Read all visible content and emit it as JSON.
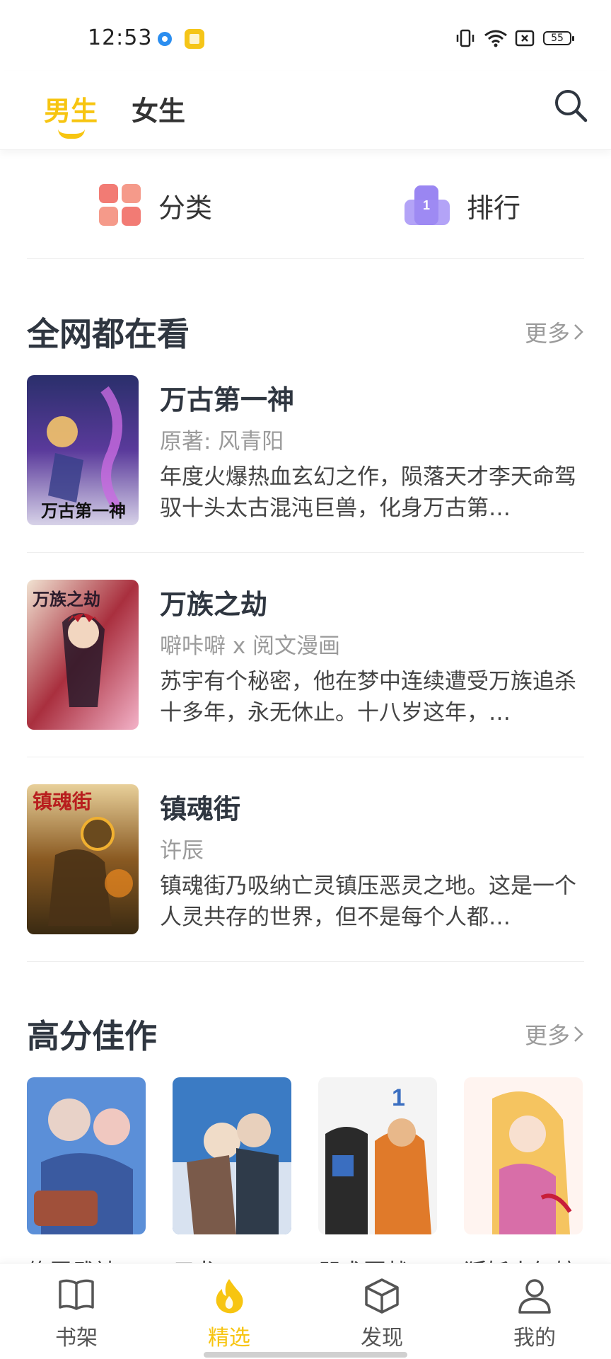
{
  "status": {
    "time": "12:53",
    "battery": "55",
    "icons": [
      "browser-icon",
      "notes-icon",
      "vibrate-icon",
      "wifi-icon",
      "sim-icon",
      "battery-icon"
    ]
  },
  "top_tabs": {
    "male": "男生",
    "female": "女生",
    "active": "male",
    "search_icon": "search-icon"
  },
  "quick": {
    "category": "分类",
    "ranking": "排行",
    "ranking_badge": "1"
  },
  "section_popular": {
    "title": "全网都在看",
    "more": "更多",
    "books": [
      {
        "title": "万古第一神",
        "author": "原著: 风青阳",
        "desc": "年度火爆热血玄幻之作，陨落天才李天命驾驭十头太古混沌巨兽，化身万古第…",
        "cover_text": "万古第一神",
        "cover_colors": [
          "#2a2f6b",
          "#8b3fb8",
          "#f4c46a"
        ]
      },
      {
        "title": "万族之劫",
        "author": "噼咔噼 x 阅文漫画",
        "desc": "苏宇有个秘密，他在梦中连续遭受万族追杀十多年，永无休止。十八岁这年，…",
        "cover_text": "万族之劫",
        "cover_colors": [
          "#3a1c2e",
          "#c0303f",
          "#f3b2c8"
        ]
      },
      {
        "title": "镇魂街",
        "author": "许辰",
        "desc": "镇魂街乃吸纳亡灵镇压恶灵之地。这是一个人灵共存的世界，但不是每个人都…",
        "cover_text": "镇魂街",
        "cover_colors": [
          "#4a3a1c",
          "#c8942e",
          "#e8d09a"
        ]
      }
    ]
  },
  "section_top": {
    "title": "高分佳作",
    "more": "更多",
    "books": [
      {
        "name": "修罗武神",
        "cover_colors": [
          "#5b8fd8",
          "#e8d2c8",
          "#a0503a"
        ]
      },
      {
        "name": "元龙",
        "cover_colors": [
          "#3b7bc4",
          "#d8e2f0",
          "#2f3b4a"
        ]
      },
      {
        "name": "咒术回战",
        "cover_colors": [
          "#f4f4f4",
          "#3a6ec0",
          "#e07a2a"
        ]
      },
      {
        "name": "狐妖小红娘",
        "cover_colors": [
          "#fff4f0",
          "#f5c460",
          "#d86ea8"
        ]
      }
    ]
  },
  "bottom_nav": {
    "items": [
      {
        "label": "书架",
        "icon": "book-icon"
      },
      {
        "label": "精选",
        "icon": "flame-icon"
      },
      {
        "label": "发现",
        "icon": "cube-icon"
      },
      {
        "label": "我的",
        "icon": "person-icon"
      }
    ],
    "active_index": 1,
    "accent": "#f7c511"
  }
}
